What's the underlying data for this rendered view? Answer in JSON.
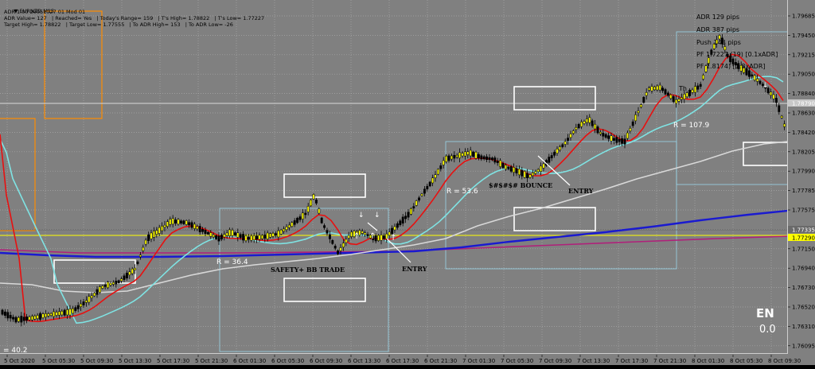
{
  "window": {
    "symbol_title": "EURNZD,M15",
    "menu_icon": "triangle-down-icon"
  },
  "info_panel": {
    "line1": "ADR 1.00 20051027 01 Mod 01",
    "line2": "ADR Value= 127   | Reached= Yes   | Today's Range= 159   | T's High= 1.78822   | T's Low= 1.77227",
    "line3": "Target High= 1.78822   | Target Low= 1.77555   | To ADR High= 153   | To ADR Low= -26"
  },
  "adr_panel": {
    "line1": "ADR   129 pips",
    "line2": "ADR   387 pips",
    "line3": "Push   143 pips",
    "line4": "PF   1.7227 (19) [0.1xADR]",
    "line5": "PF   1.8174) [1.8xADR]"
  },
  "annotations": {
    "safety_trade": "SAFETY+ BB TRADE",
    "entry_1": "ENTRY",
    "bounce": "$#$#$# BOUNCE",
    "entry_2": "ENTRY",
    "r_1": "R = 36.4",
    "r_2": "R = 53.6",
    "r_3": "R = 107.9",
    "r_4": "= 40.2",
    "th_label": "Th"
  },
  "corner": {
    "label": "EN",
    "value": "0.0"
  },
  "price_axis": {
    "ticks": [
      "1.79685",
      "1.79450",
      "1.79215",
      "1.79050",
      "1.78840",
      "1.78630",
      "1.78420",
      "1.78205",
      "1.77990",
      "1.77785",
      "1.77575",
      "1.77360",
      "1.77150",
      "1.76940",
      "1.76730",
      "1.76520",
      "1.76310",
      "1.76095"
    ],
    "highlight_yellow": "1.77290",
    "highlight_gray": "1.77335",
    "highlight_silver": "1.78790"
  },
  "time_axis": {
    "labels": [
      "5 Oct 2020",
      "5 Oct 05:30",
      "5 Oct 09:30",
      "5 Oct 13:30",
      "5 Oct 17:30",
      "5 Oct 21:30",
      "6 Oct 01:30",
      "6 Oct 05:30",
      "6 Oct 09:30",
      "6 Oct 13:30",
      "6 Oct 17:30",
      "6 Oct 21:30",
      "7 Oct 01:30",
      "7 Oct 05:30",
      "7 Oct 09:30",
      "7 Oct 13:30",
      "7 Oct 17:30",
      "7 Oct 21:30",
      "8 Oct 01:30",
      "8 Oct 05:30",
      "8 Oct 09:30"
    ]
  },
  "colors": {
    "background": "#808080",
    "bull_candle": "#ffff00",
    "bear_candle": "#000000",
    "ma_red": "#e81010",
    "ma_cyan": "#7fe3e3",
    "ma_white": "#d8d8d8",
    "ma_blue": "#1a1ad0",
    "ma_magenta": "#b0207a",
    "orange_box": "#ff8c00",
    "yellow_line": "#ffff00"
  }
}
